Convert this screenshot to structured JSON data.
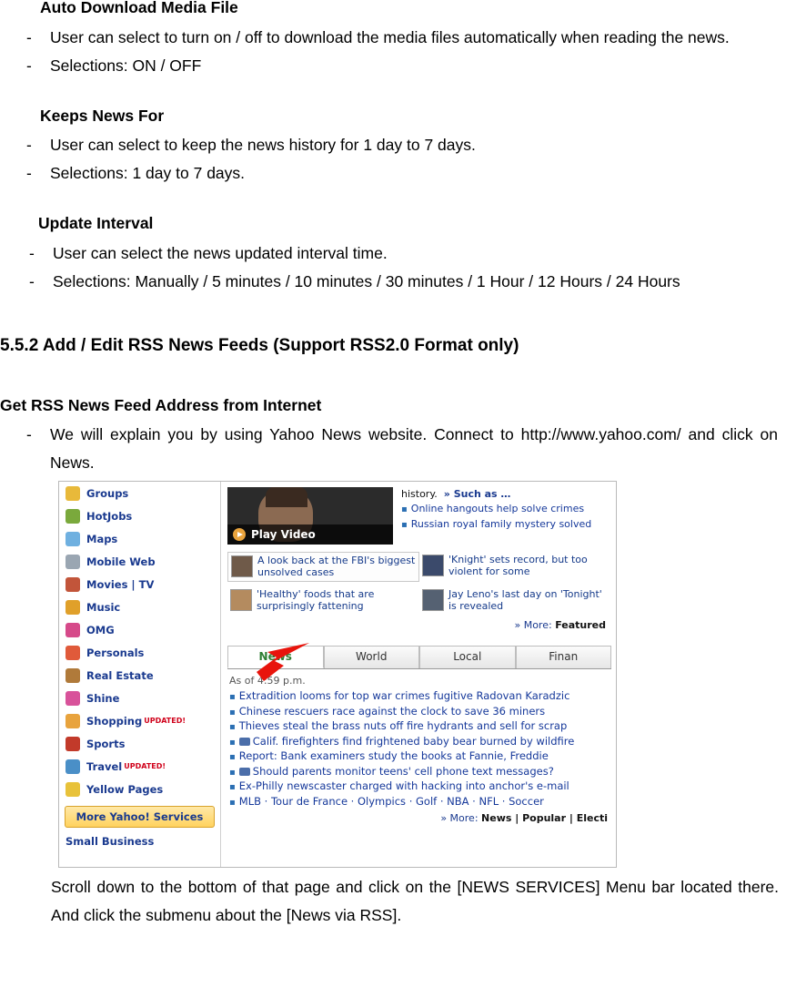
{
  "doc": {
    "sections": [
      {
        "title": "Auto Download Media File",
        "bullets": [
          "User can select to turn on / off to download the media files automatically when reading the news.",
          "Selections: ON / OFF"
        ]
      },
      {
        "title": "Keeps News For",
        "bullets": [
          "User can select to keep the news history for 1 day to 7 days.",
          "Selections: 1 day to 7 days."
        ]
      },
      {
        "title": "Update Interval",
        "bullets": [
          "User can select the news updated interval time.",
          "Selections: Manually / 5 minutes / 10 minutes / 30 minutes / 1 Hour / 12 Hours / 24 Hours"
        ]
      }
    ],
    "heading_552": "5.5.2 Add / Edit RSS News Feeds (Support RSS2.0 Format only)",
    "heading_get": "Get RSS News Feed Address from Internet",
    "get_bullet": "We will explain you by using Yahoo News website. Connect to http://www.yahoo.com/ and click on News.",
    "dash": "-",
    "tail_text_1": "Scroll down to the bottom of that page and click on the [",
    "tail_kw_1": "NEWS SERVICES",
    "tail_text_2": "] Menu bar located there. And click the submenu about the [News via RSS]."
  },
  "screenshot": {
    "sidebar": [
      {
        "label": "Groups",
        "icon": "groups-icon",
        "color": "#e8b93a",
        "new": ""
      },
      {
        "label": "HotJobs",
        "icon": "hotjobs-icon",
        "color": "#7aa93c",
        "new": ""
      },
      {
        "label": "Maps",
        "icon": "maps-icon",
        "color": "#6fb0e0",
        "new": ""
      },
      {
        "label": "Mobile Web",
        "icon": "mobile-web-icon",
        "color": "#9aa6b2",
        "new": ""
      },
      {
        "label": "Movies | TV",
        "icon": "movies-tv-icon",
        "color": "#c2553a",
        "new": ""
      },
      {
        "label": "Music",
        "icon": "music-icon",
        "color": "#e0a02a",
        "new": ""
      },
      {
        "label": "OMG",
        "icon": "omg-icon",
        "color": "#d64a8a",
        "new": ""
      },
      {
        "label": "Personals",
        "icon": "personals-icon",
        "color": "#e05a3a",
        "new": ""
      },
      {
        "label": "Real Estate",
        "icon": "real-estate-icon",
        "color": "#b07a3a",
        "new": ""
      },
      {
        "label": "Shine",
        "icon": "shine-icon",
        "color": "#d8529a",
        "new": ""
      },
      {
        "label": "Shopping",
        "icon": "shopping-icon",
        "color": "#e8a33d",
        "new": "UPDATED!"
      },
      {
        "label": "Sports",
        "icon": "sports-icon",
        "color": "#c23a2a",
        "new": ""
      },
      {
        "label": "Travel",
        "icon": "travel-icon",
        "color": "#4a8fc7",
        "new": "UPDATED!"
      },
      {
        "label": "Yellow Pages",
        "icon": "yellow-pages-icon",
        "color": "#e8c23a",
        "new": ""
      }
    ],
    "more_services": "More Yahoo! Services",
    "small_business": "Small Business",
    "video_label": "Play Video",
    "top_right_list": {
      "history": "history.",
      "such_as": "» Such as …",
      "items": [
        "Online hangouts help solve crimes",
        "Russian royal family mystery solved"
      ]
    },
    "thumbs": [
      "A look back at the FBI's biggest unsolved cases",
      "'Knight' sets record, but too violent for some",
      "'Healthy' foods that are surprisingly fattening",
      "Jay Leno's last day on 'Tonight' is revealed"
    ],
    "more_featured_prefix": "» More:",
    "more_featured_link": "Featured",
    "tabs": [
      "News",
      "World",
      "Local",
      "Finan"
    ],
    "active_tab": "News",
    "as_of": "As of 4:59 p.m.",
    "headlines": [
      {
        "text": "Extradition looms for top war crimes fugitive Radovan Karadzic",
        "cam": false
      },
      {
        "text": "Chinese rescuers race against the clock to save 36 miners",
        "cam": false
      },
      {
        "text": "Thieves steal the brass nuts off fire hydrants and sell for scrap",
        "cam": false
      },
      {
        "text": "Calif. firefighters find frightened baby bear burned by wildfire",
        "cam": true
      },
      {
        "text": "Report: Bank examiners study the books at Fannie, Freddie",
        "cam": false
      },
      {
        "text": "Should parents monitor teens' cell phone text messages?",
        "cam": true
      },
      {
        "text": "Ex-Philly newscaster charged with hacking into anchor's e-mail",
        "cam": false
      },
      {
        "text": "MLB · Tour de France · Olympics · Golf · NBA · NFL · Soccer",
        "cam": false
      }
    ],
    "headlines_footer_prefix": "» More:",
    "headlines_footer_links": "News | Popular | Electi",
    "arrow_color": "#e8140c"
  }
}
